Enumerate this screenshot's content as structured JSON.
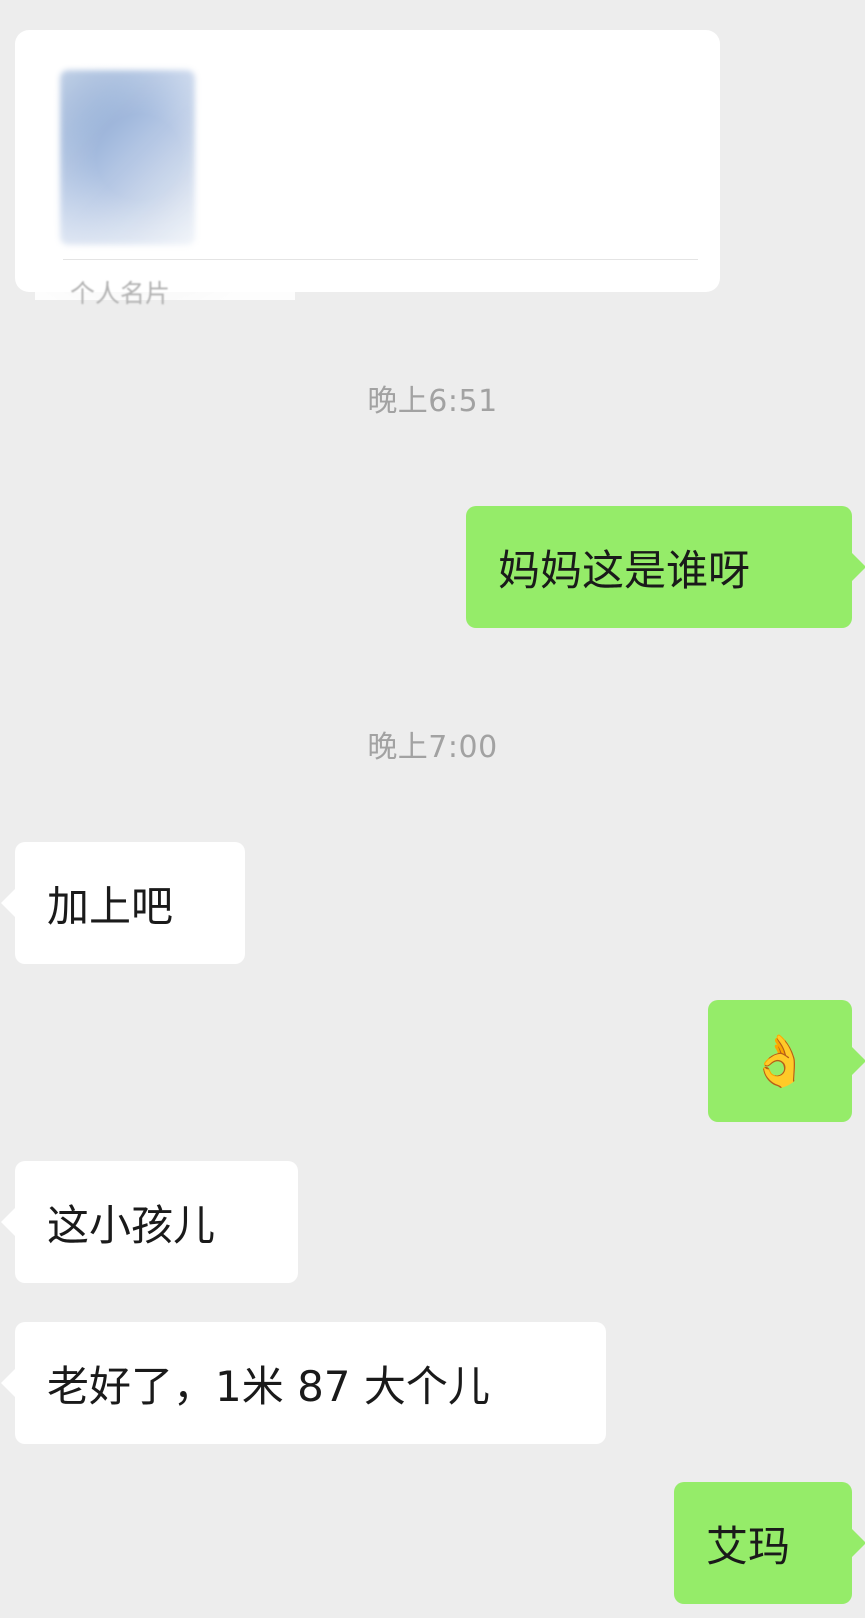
{
  "contact_card": {
    "label": "个人名片"
  },
  "messages": {
    "time_1": "晚上6:51",
    "msg_1": "妈妈这是谁呀",
    "time_2": "晚上7:00",
    "msg_2": "加上吧",
    "msg_3_emoji": "👌",
    "msg_4": "这小孩儿",
    "msg_5": "老好了，1米 87 大个儿",
    "msg_6": "艾玛"
  },
  "colors": {
    "background": "#ededed",
    "outgoing_bubble": "#95ec69",
    "incoming_bubble": "#ffffff",
    "timestamp": "#a2a2a2"
  }
}
